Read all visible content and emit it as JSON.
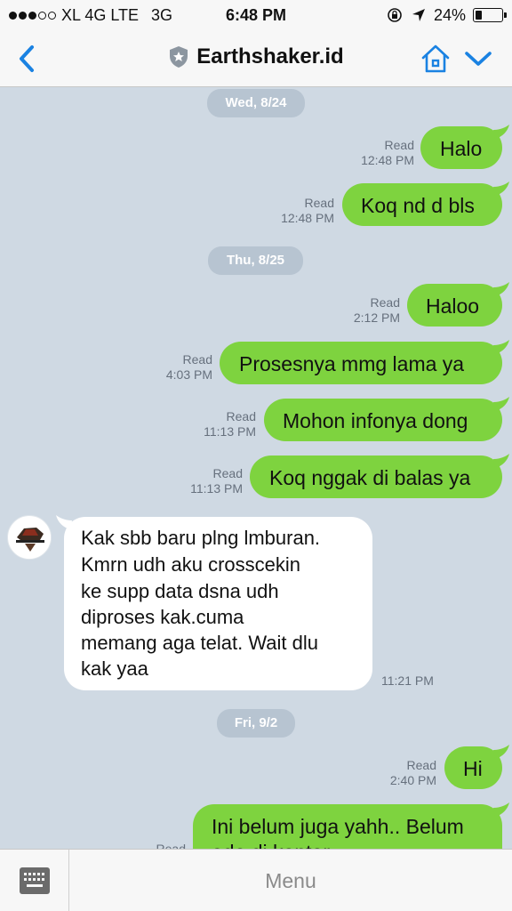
{
  "status_bar": {
    "carrier": "XL 4G LTE",
    "network": "3G",
    "time": "6:48 PM",
    "battery": "24%",
    "battery_level": 0.24,
    "signal_bars": 3
  },
  "nav": {
    "title": "Earthshaker.id",
    "accent_color": "#1a82e2"
  },
  "chat": {
    "dates": [
      "Wed, 8/24",
      "Thu, 8/25",
      "Fri, 9/2"
    ],
    "messages": [
      {
        "text": "Halo",
        "status": "Read",
        "time": "12:48 PM"
      },
      {
        "text": "Koq nd d bls",
        "status": "Read",
        "time": "12:48 PM"
      },
      {
        "text": "Haloo",
        "status": "Read",
        "time": "2:12 PM"
      },
      {
        "text": "Prosesnya mmg lama ya",
        "status": "Read",
        "time": "4:03 PM"
      },
      {
        "text": "Mohon infonya dong",
        "status": "Read",
        "time": "11:13 PM"
      },
      {
        "text": "Koq nggak di balas ya",
        "status": "Read",
        "time": "11:13 PM"
      },
      {
        "lines": [
          "Kak sbb baru plng lmburan.",
          "Kmrn udh aku crosscekin",
          "ke supp data dsna udh",
          "diproses kak.cuma",
          "memang aga telat. Wait dlu",
          "kak yaa"
        ],
        "time": "11:21 PM"
      },
      {
        "text": "Hi",
        "status": "Read",
        "time": "2:40 PM"
      },
      {
        "lines": [
          "Ini belum juga yahh.. Belum",
          "ada di kantor"
        ],
        "status": "Read"
      }
    ],
    "outgoing_color": "#7ed33f",
    "incoming_color": "#ffffff"
  },
  "bottom": {
    "menu_label": "Menu"
  }
}
